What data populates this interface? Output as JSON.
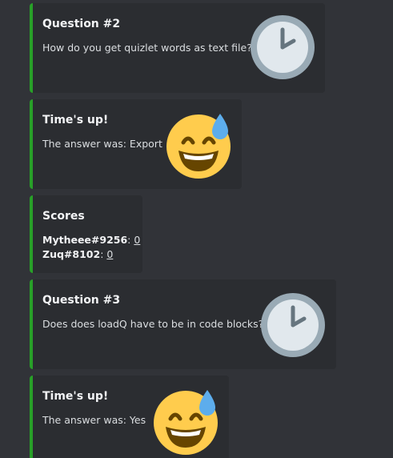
{
  "messages": [
    {
      "title": "Question #2",
      "description": "How do you get quizlet words as text file?",
      "icon": "clock-icon"
    },
    {
      "title": "Time's up!",
      "description": "The answer was: Export",
      "icon": "grinning-sweat-emoji-icon"
    },
    {
      "title": "Scores",
      "scores": [
        {
          "name": "Mytheee#9256",
          "sep": ": ",
          "value": "0"
        },
        {
          "name": "Zuq#8102",
          "sep": ": ",
          "value": "0"
        }
      ]
    },
    {
      "title": "Question #3",
      "description": "Does does loadQ have to be in code blocks?",
      "icon": "clock-icon"
    },
    {
      "title": "Time's up!",
      "description": "The answer was: Yes",
      "icon": "grinning-sweat-emoji-icon"
    }
  ],
  "colors": {
    "background": "#313338",
    "embed_background": "#2b2d31",
    "embed_accent": "#28a028"
  }
}
